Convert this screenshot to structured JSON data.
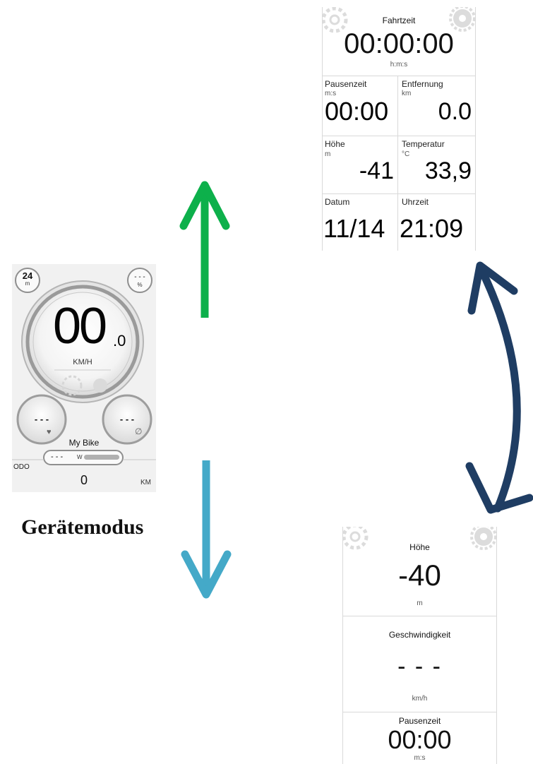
{
  "device_mode": {
    "caption": "Gerätemodus",
    "altitude_badge": {
      "value": "24",
      "unit": "m"
    },
    "battery_badge": {
      "value": "- - -",
      "unit": "%"
    },
    "speed": {
      "integer": "00",
      "decimal": ".0",
      "unit": "KM/H"
    },
    "heart_rate": {
      "value": "- - -",
      "icon": "heart-icon"
    },
    "cadence": {
      "value": "- - -",
      "icon": "cadence-icon"
    },
    "bike_name": "My Bike",
    "power": {
      "value": "- - -",
      "unit": "W"
    },
    "odo": {
      "label": "ODO",
      "value": "0",
      "unit": "KM"
    }
  },
  "trip_screen": {
    "ride_time": {
      "label": "Fahrtzeit",
      "value": "00:00:00",
      "unit": "h:m:s"
    },
    "pause_time": {
      "label": "Pausenzeit",
      "unit": "m:s",
      "value": "00:00"
    },
    "distance": {
      "label": "Entfernung",
      "unit": "km",
      "value": "0.0"
    },
    "altitude": {
      "label": "Höhe",
      "unit": "m",
      "value": "-41"
    },
    "temperature": {
      "label": "Temperatur",
      "unit": "°C",
      "value": "33,9"
    },
    "date": {
      "label": "Datum",
      "value": "11/14"
    },
    "time": {
      "label": "Uhrzeit",
      "value": "21:09"
    }
  },
  "altitude_screen": {
    "altitude": {
      "label": "Höhe",
      "value": "-40",
      "unit": "m"
    },
    "speed": {
      "label": "Geschwindigkeit",
      "value": "- - -",
      "unit": "km/h"
    },
    "pause_time": {
      "label": "Pausenzeit",
      "value": "00:00",
      "unit": "m:s"
    }
  },
  "colors": {
    "arrow_up": "#0db04b",
    "arrow_down": "#44a9c8",
    "arrow_swap": "#1f3d63",
    "gear": "#dcdcdc"
  }
}
